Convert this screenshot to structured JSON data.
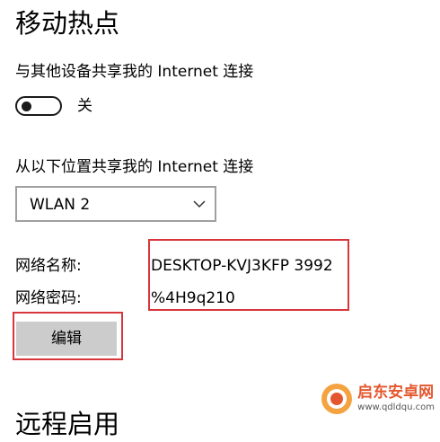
{
  "page": {
    "title": "移动热点",
    "next_section_title": "远程启用"
  },
  "share": {
    "label": "与其他设备共享我的 Internet 连接",
    "toggle_state": "关",
    "toggle_on": false
  },
  "source": {
    "label": "从以下位置共享我的 Internet 连接",
    "selected": "WLAN 2"
  },
  "network": {
    "name_label": "网络名称:",
    "name_value": "DESKTOP-KVJ3KFP 3992",
    "password_label": "网络密码:",
    "password_value": "%4H9q210"
  },
  "actions": {
    "edit_label": "编辑"
  },
  "watermark": {
    "main": "启东安卓网",
    "url": "www.qdldqu.com"
  },
  "colors": {
    "highlight": "#d9363b",
    "button_bg": "#cccccc",
    "dropdown_border": "#a0a0a0"
  }
}
